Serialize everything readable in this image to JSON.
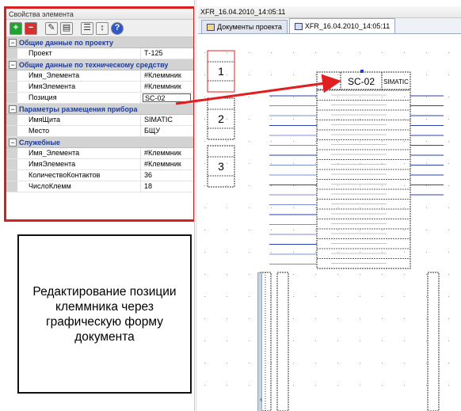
{
  "props_panel": {
    "title": "Свойства элемента",
    "toolbar": [
      {
        "icon": "add-icon",
        "glyph": "+"
      },
      {
        "icon": "delete-icon",
        "glyph": "−"
      },
      {
        "icon": "edit-icon",
        "glyph": "✎"
      },
      {
        "icon": "document-icon",
        "glyph": "▤"
      },
      {
        "icon": "list-icon",
        "glyph": "☰"
      },
      {
        "icon": "sort-icon",
        "glyph": "↕"
      },
      {
        "icon": "help-icon",
        "glyph": "?"
      }
    ],
    "categories": [
      {
        "label": "Общие данные по проекту",
        "toggle": "−",
        "rows": [
          {
            "name": "Проект",
            "value": "Т-125"
          }
        ]
      },
      {
        "label": "Общие данные по техническому средству",
        "toggle": "−",
        "rows": [
          {
            "name": "Имя_Элемента",
            "value": "#Клеммник"
          },
          {
            "name": "ИмяЭлемента",
            "value": "#Клеммник"
          },
          {
            "name": "Позиция",
            "value": "SC-02",
            "editing": true
          }
        ]
      },
      {
        "label": "Параметры размещения прибора",
        "toggle": "−",
        "rows": [
          {
            "name": "ИмяЩита",
            "value": "SIMATIC"
          },
          {
            "name": "Место",
            "value": "БЩУ"
          }
        ]
      },
      {
        "label": "Служебные",
        "toggle": "−",
        "rows": [
          {
            "name": "Имя_Элемента",
            "value": "#Клеммник"
          },
          {
            "name": "ИмяЭлемента",
            "value": "#Клеммник"
          },
          {
            "name": "КоличествоКонтактов",
            "value": "36"
          },
          {
            "name": "ЧислоКлемм",
            "value": "18"
          }
        ]
      }
    ]
  },
  "description": "Редактирование позиции клеммника через графическую форму документа",
  "document": {
    "window_title": "XFR_16.04.2010_14:05:11",
    "tabs": [
      {
        "label": "Документы проекта",
        "icon": "tree-icon",
        "active": false
      },
      {
        "label": "XFR_16.04.2010_14:05:11",
        "icon": "drawing-icon",
        "active": true
      }
    ],
    "drawing": {
      "section_numbers": [
        "1",
        "2",
        "3"
      ],
      "terminal_header": {
        "count": "18",
        "position": "SC-02",
        "panel": "SIMATIC"
      },
      "terminal_count": 18
    }
  },
  "colors": {
    "highlight_red": "#e02020",
    "category_text": "#1f3d99",
    "wire_blue": "#2a3fb0"
  }
}
